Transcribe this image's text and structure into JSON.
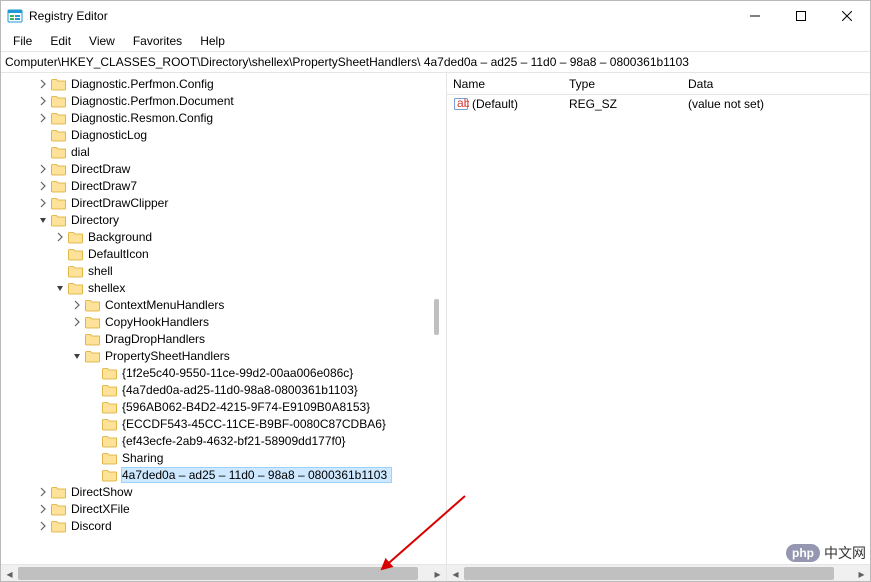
{
  "window": {
    "title": "Registry Editor"
  },
  "menu": {
    "file": "File",
    "edit": "Edit",
    "view": "View",
    "favorites": "Favorites",
    "help": "Help"
  },
  "address": "Computer\\HKEY_CLASSES_ROOT\\Directory\\shellex\\PropertySheetHandlers\\ 4a7ded0a – ad25 – 11d0 – 98a8 – 0800361b1103",
  "cols": {
    "name": "Name",
    "type": "Type",
    "data": "Data"
  },
  "value": {
    "name": "(Default)",
    "type": "REG_SZ",
    "data": "(value not set)"
  },
  "tree": [
    {
      "indent": 2,
      "chev": "closed",
      "label": "Diagnostic.Perfmon.Config"
    },
    {
      "indent": 2,
      "chev": "closed",
      "label": "Diagnostic.Perfmon.Document"
    },
    {
      "indent": 2,
      "chev": "closed",
      "label": "Diagnostic.Resmon.Config"
    },
    {
      "indent": 2,
      "chev": "none",
      "label": "DiagnosticLog"
    },
    {
      "indent": 2,
      "chev": "none",
      "label": "dial"
    },
    {
      "indent": 2,
      "chev": "closed",
      "label": "DirectDraw"
    },
    {
      "indent": 2,
      "chev": "closed",
      "label": "DirectDraw7"
    },
    {
      "indent": 2,
      "chev": "closed",
      "label": "DirectDrawClipper"
    },
    {
      "indent": 2,
      "chev": "open",
      "label": "Directory"
    },
    {
      "indent": 3,
      "chev": "closed",
      "label": "Background"
    },
    {
      "indent": 3,
      "chev": "none",
      "label": "DefaultIcon"
    },
    {
      "indent": 3,
      "chev": "none",
      "label": "shell"
    },
    {
      "indent": 3,
      "chev": "open",
      "label": "shellex"
    },
    {
      "indent": 4,
      "chev": "closed",
      "label": "ContextMenuHandlers"
    },
    {
      "indent": 4,
      "chev": "closed",
      "label": "CopyHookHandlers"
    },
    {
      "indent": 4,
      "chev": "none",
      "label": "DragDropHandlers"
    },
    {
      "indent": 4,
      "chev": "open",
      "label": "PropertySheetHandlers"
    },
    {
      "indent": 5,
      "chev": "none",
      "label": "{1f2e5c40-9550-11ce-99d2-00aa006e086c}"
    },
    {
      "indent": 5,
      "chev": "none",
      "label": "{4a7ded0a-ad25-11d0-98a8-0800361b1103}"
    },
    {
      "indent": 5,
      "chev": "none",
      "label": "{596AB062-B4D2-4215-9F74-E9109B0A8153}"
    },
    {
      "indent": 5,
      "chev": "none",
      "label": "{ECCDF543-45CC-11CE-B9BF-0080C87CDBA6}"
    },
    {
      "indent": 5,
      "chev": "none",
      "label": "{ef43ecfe-2ab9-4632-bf21-58909dd177f0}"
    },
    {
      "indent": 5,
      "chev": "none",
      "label": "Sharing"
    },
    {
      "indent": 5,
      "chev": "none",
      "label": " 4a7ded0a – ad25 – 11d0 – 98a8 – 0800361b1103",
      "selected": true
    },
    {
      "indent": 2,
      "chev": "closed",
      "label": "DirectShow"
    },
    {
      "indent": 2,
      "chev": "closed",
      "label": "DirectXFile"
    },
    {
      "indent": 2,
      "chev": "closed",
      "label": "Discord"
    }
  ],
  "watermark": {
    "php": "php",
    "cn": "中文网"
  }
}
